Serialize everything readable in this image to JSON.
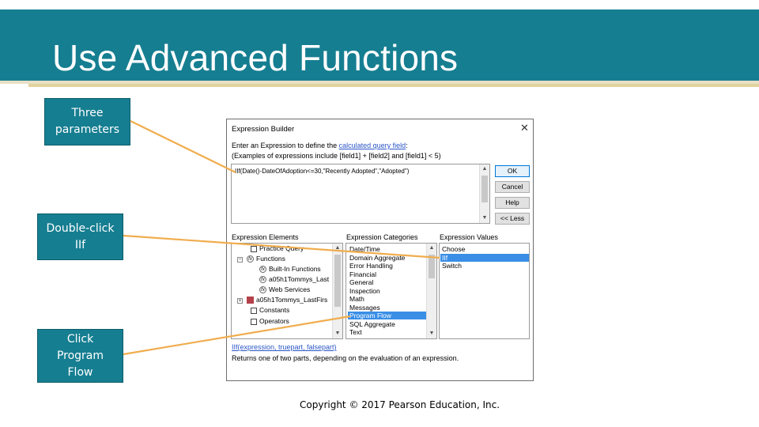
{
  "slide": {
    "title": "Use Advanced Functions",
    "copyright": "Copyright © 2017 Pearson Education, Inc."
  },
  "callouts": [
    {
      "lines": [
        "Three",
        "parameters"
      ]
    },
    {
      "lines": [
        "Double-click",
        "IIf"
      ]
    },
    {
      "lines": [
        "Click",
        "Program",
        "Flow"
      ]
    }
  ],
  "colors": {
    "banner": "#167e91",
    "accent_line": "#e2d29c",
    "leader": "#f0ad4e",
    "selection": "#3a8ee6"
  },
  "dialog": {
    "title": "Expression Builder",
    "close_icon": "close-icon",
    "instruction_prefix": "Enter an Expression to define the ",
    "instruction_link": "calculated query field",
    "instruction_suffix": ":",
    "examples": "(Examples of expressions include [field1] + [field2] and [field1] < 5)",
    "expression": "IIf(Date()-DateOfAdoption<=30,\"Recently Adopted\",\"Adopted\")",
    "buttons": {
      "ok": "OK",
      "cancel": "Cancel",
      "help": "Help",
      "less": "<< Less"
    },
    "elements_label": "Expression Elements",
    "categories_label": "Expression Categories",
    "values_label": "Expression Values",
    "elements": [
      {
        "label": "Practice Query",
        "icon": "query-icon"
      },
      {
        "label": "Functions",
        "icon": "function-icon",
        "expander": "−"
      },
      {
        "label": "Built-In Functions",
        "icon": "function-icon"
      },
      {
        "label": "a05h1Tommys_Last",
        "icon": "function-icon"
      },
      {
        "label": "Web Services",
        "icon": "function-icon"
      },
      {
        "label": "a05h1Tommys_LastFirs",
        "icon": "database-icon",
        "expander": "+"
      },
      {
        "label": "Constants",
        "icon": "folder-icon"
      },
      {
        "label": "Operators",
        "icon": "folder-icon"
      }
    ],
    "categories": [
      "Date/Time",
      "Domain Aggregate",
      "Error Handling",
      "Financial",
      "General",
      "Inspection",
      "Math",
      "Messages",
      "Program Flow",
      "SQL Aggregate",
      "Text"
    ],
    "selected_category": "Program Flow",
    "values": [
      "Choose",
      "IIf",
      "Switch"
    ],
    "selected_value": "IIf",
    "syntax": "IIf(expression, truepart, falsepart)",
    "description": "Returns one of two parts, depending on the evaluation of an expression."
  }
}
